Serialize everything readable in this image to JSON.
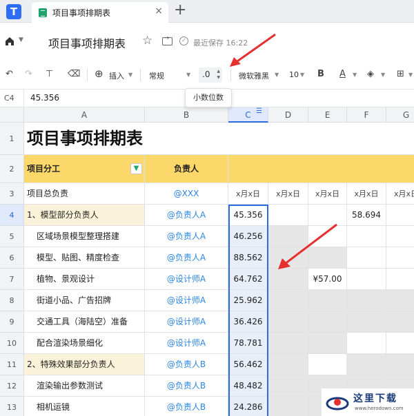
{
  "tab": {
    "title": "项目事项排期表"
  },
  "header": {
    "title": "项目事项排期表",
    "saved": "最近保存 16:22"
  },
  "toolbar": {
    "insert": "插入",
    "number_format": "常规",
    "decimal": ".0",
    "font_family": "微软雅黑",
    "font_size": "10",
    "bold": "B",
    "text_color": "A"
  },
  "tooltip": "小数位数",
  "formula": {
    "cell_ref": "C4",
    "value": "45.356"
  },
  "columns": [
    "A",
    "B",
    "C",
    "D",
    "E",
    "F",
    "G"
  ],
  "rows": [
    "1",
    "2",
    "3",
    "4",
    "5",
    "6",
    "7",
    "8",
    "9",
    "10",
    "11",
    "12",
    "13"
  ],
  "sheet": {
    "title": "项目事项排期表",
    "headers": {
      "a": "项目分工",
      "b": "负责人"
    },
    "date_label": "x月x日",
    "row3": {
      "a": "项目总负责",
      "b": "@XXX"
    },
    "data_rows": [
      {
        "a": "1、模型部分负责人",
        "b": "@负责人A",
        "c": "45.356",
        "f": "58.694"
      },
      {
        "a": "区域场景模型整理搭建",
        "b": "@负责人A",
        "c": "46.256"
      },
      {
        "a": "模型、贴图、精度检查",
        "b": "@负责人A",
        "c": "88.562"
      },
      {
        "a": "植物、景观设计",
        "b": "@设计师A",
        "c": "64.762",
        "e": "¥57.00"
      },
      {
        "a": "街道小品、广告招牌",
        "b": "@设计师A",
        "c": "25.962"
      },
      {
        "a": "交通工具（海陆空）准备",
        "b": "@设计师A",
        "c": "36.426"
      },
      {
        "a": "配合渲染场景细化",
        "b": "@设计师A",
        "c": "78.781"
      },
      {
        "a": "2、特殊效果部分负责人",
        "b": "@负责人B",
        "c": "56.462"
      },
      {
        "a": "渲染输出参数测试",
        "b": "@负责人B",
        "c": "48.482"
      },
      {
        "a": "相机运镜",
        "b": "@负责人B",
        "c": "24.286"
      }
    ]
  },
  "watermark": {
    "text": "这里下载",
    "url": "www.herodown.com"
  },
  "colors": {
    "accent": "#2a6be0",
    "header_yellow": "#fcd86a",
    "link": "#2b85e4",
    "arrow": "#e53030"
  }
}
